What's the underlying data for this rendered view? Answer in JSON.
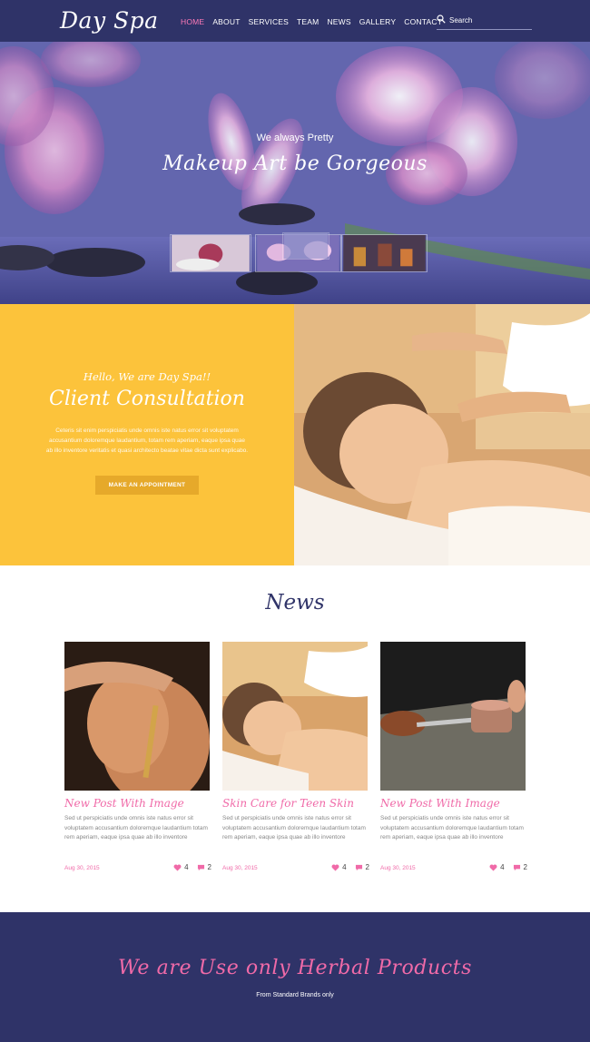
{
  "header": {
    "logo": "Day Spa",
    "nav": [
      "HOME",
      "ABOUT",
      "SERVICES",
      "TEAM",
      "NEWS",
      "GALLERY",
      "CONTACT"
    ],
    "active_nav": "HOME",
    "search_placeholder": "Search",
    "search_icon": "search-icon"
  },
  "hero": {
    "subtitle": "We always Pretty",
    "title": "Makeup Art be Gorgeous"
  },
  "consultation": {
    "hello": "Hello, We are Day Spa!!",
    "title": "Client Consultation",
    "text": "Ceteris sit enim perspiciatis unde omnis iste natus error sit voluptatem accusantium doloremque laudantium, totam rem aperiam, eaque ipsa quae ab illo inventore veritatis et quasi architecto beatae vitae dicta sunt explicabo.",
    "button": "MAKE AN APPOINTMENT"
  },
  "news": {
    "heading": "News",
    "cards": [
      {
        "title": "New Post With Image",
        "text": "Sed ut perspiciatis unde omnis iste natus error sit voluptatem accusantium doloremque laudantium totam rem aperiam, eaque ipsa quae ab illo inventore",
        "date": "Aug 30, 2015",
        "likes": "4",
        "comments": "2"
      },
      {
        "title": "Skin Care for Teen Skin",
        "text": "Sed ut perspiciatis unde omnis iste natus error sit voluptatem accusantium doloremque laudantium totam rem aperiam, eaque ipsa quae ab illo inventore",
        "date": "Aug 30, 2015",
        "likes": "4",
        "comments": "2"
      },
      {
        "title": "New Post With Image",
        "text": "Sed ut perspiciatis unde omnis iste natus error sit voluptatem accusantium doloremque laudantium totam rem aperiam, eaque ipsa quae ab illo inventore",
        "date": "Aug 30, 2015",
        "likes": "4",
        "comments": "2"
      }
    ]
  },
  "herbal": {
    "title": "We are Use only Herbal Products",
    "subtitle": "From Standard Brands only"
  },
  "colors": {
    "navy": "#2f3368",
    "pink": "#f06aa8",
    "yellow": "#fcc33b"
  }
}
